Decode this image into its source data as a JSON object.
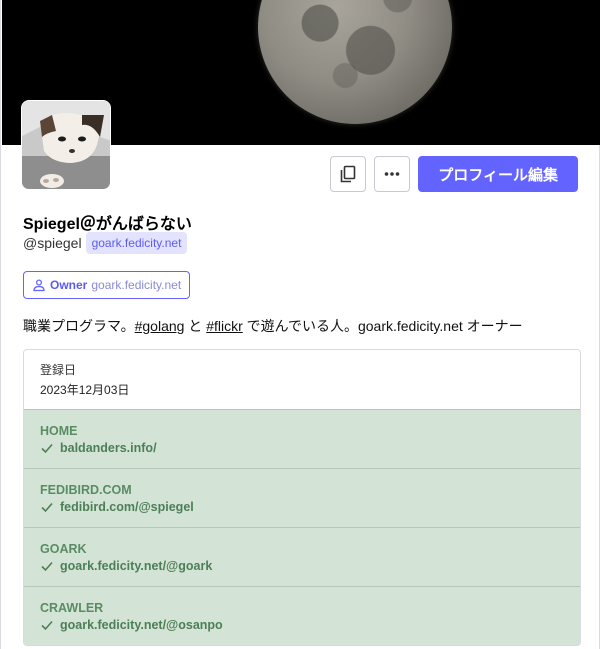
{
  "profile": {
    "display_name": "Spiegel＠がんばらない",
    "handle": "@spiegel",
    "domain_badge": "goark.fedicity.net",
    "role": {
      "name": "Owner",
      "domain": "goark.fedicity.net"
    },
    "bio": {
      "text1": "職業プログラマ。",
      "tag1": "#golang",
      "text2": " と ",
      "tag2": "#flickr",
      "text3": " で遊んでいる人。goark.fedicity.net オーナー"
    },
    "actions": {
      "edit_label": "プロフィール編集"
    }
  },
  "fields": {
    "joined": {
      "label": "登録日",
      "value": "2023年12月03日"
    },
    "items": [
      {
        "name": "HOME",
        "value": "baldanders.info/"
      },
      {
        "name": "FEDIBIRD.COM",
        "value": "fedibird.com/@spiegel"
      },
      {
        "name": "GOARK",
        "value": "goark.fedicity.net/@goark"
      },
      {
        "name": "CRAWLER",
        "value": "goark.fedicity.net/@osanpo"
      }
    ]
  },
  "icons": {
    "copy": "copy-icon",
    "more": "more-icon",
    "role": "user-icon",
    "verified": "check-icon"
  },
  "colors": {
    "accent": "#6364ff",
    "verified_bg": "#d3e4d7",
    "verified_text": "#4d7f56"
  }
}
